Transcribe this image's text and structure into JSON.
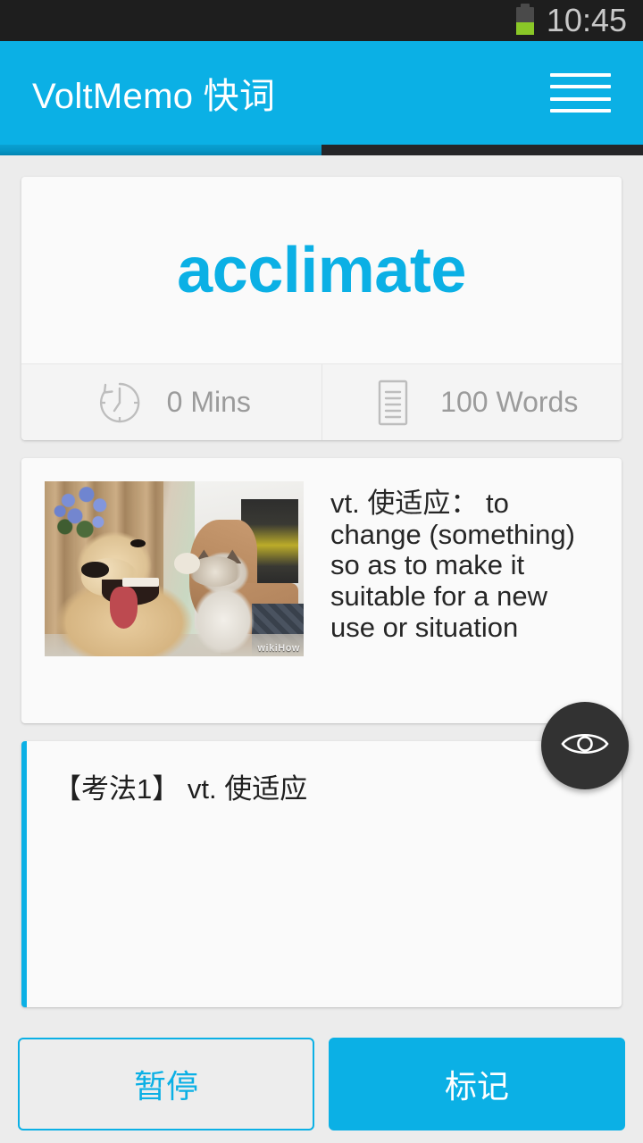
{
  "statusbar": {
    "time": "10:45",
    "battery_icon": "battery-icon",
    "battery_level_percent": 42
  },
  "appbar": {
    "title": "VoltMemo 快词",
    "menu_icon": "hamburger-menu-icon",
    "background_color": "#0bb0e5"
  },
  "progress": {
    "percent": 50,
    "fill_color": "#0696c6",
    "track_color": "#252528"
  },
  "word_card": {
    "word": "acclimate",
    "word_color": "#0bb0e5",
    "stats": [
      {
        "icon": "clock-icon",
        "label": "0 Mins"
      },
      {
        "icon": "document-icon",
        "label": "100 Words"
      }
    ]
  },
  "definition_card": {
    "image": {
      "icon": "word-illustration-photo",
      "alt": "golden retriever dog lying beside a kitten held by a person",
      "watermark": "wikiHow"
    },
    "text": "vt. 使适应： to change (something) so as to make it suitable for a new use or situation"
  },
  "notes_card": {
    "text": "【考法1】 vt. 使适应",
    "accent_color": "#0bb0e5"
  },
  "reveal_button": {
    "icon": "eye-icon",
    "background_color": "#323232"
  },
  "actions": {
    "pause_label": "暂停",
    "mark_label": "标记"
  }
}
